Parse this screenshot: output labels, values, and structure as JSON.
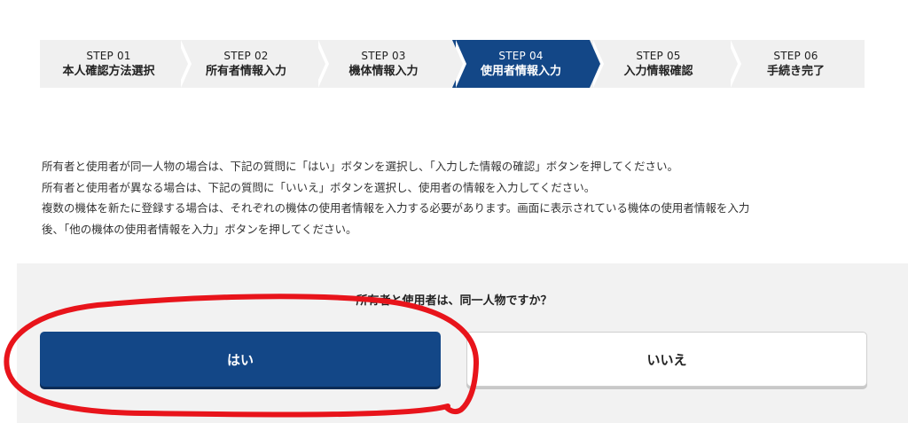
{
  "steps": [
    {
      "num": "STEP 01",
      "label": "本人確認方法選択",
      "active": false
    },
    {
      "num": "STEP 02",
      "label": "所有者情報入力",
      "active": false
    },
    {
      "num": "STEP 03",
      "label": "機体情報入力",
      "active": false
    },
    {
      "num": "STEP 04",
      "label": "使用者情報入力",
      "active": true
    },
    {
      "num": "STEP 05",
      "label": "入力情報確認",
      "active": false
    },
    {
      "num": "STEP 06",
      "label": "手続き完了",
      "active": false
    }
  ],
  "instructions": {
    "line1": "所有者と使用者が同一人物の場合は、下記の質問に「はい」ボタンを選択し、「入力した情報の確認」ボタンを押してください。",
    "line2": "所有者と使用者が異なる場合は、下記の質問に「いいえ」ボタンを選択し、使用者の情報を入力してください。",
    "line3": "複数の機体を新たに登録する場合は、それぞれの機体の使用者情報を入力する必要があります。画面に表示されている機体の使用者情報を入力",
    "line4": "後、「他の機体の使用者情報を入力」ボタンを押してください。"
  },
  "question": "所有者と使用者は、同一人物ですか？",
  "buttons": {
    "yes": "はい",
    "no": "いいえ"
  },
  "colors": {
    "accent": "#134787",
    "annotation": "#e8141b"
  }
}
